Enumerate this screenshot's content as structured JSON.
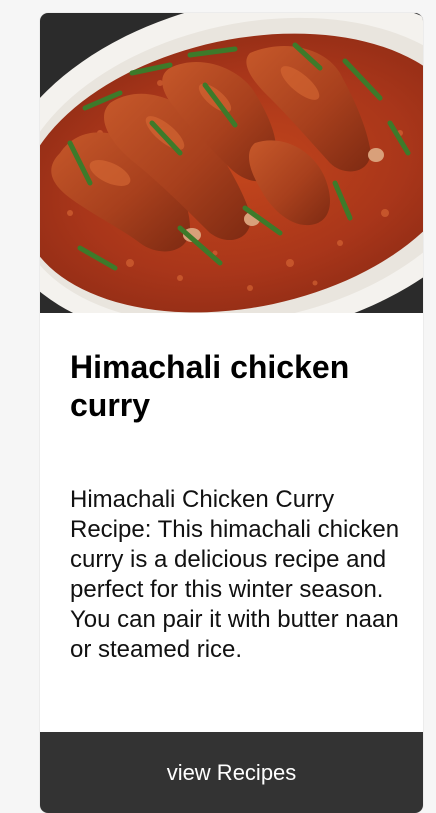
{
  "card": {
    "image": {
      "subject": "chicken curry with drumsticks in red gravy on a white oval platter"
    },
    "title": "Himachali chicken curry",
    "description": "Himachali Chicken Curry Recipe: This himachali chicken curry is a delicious recipe and perfect for this winter season. You can pair it with butter naan or steamed rice.",
    "button_label": "view Recipes"
  },
  "colors": {
    "page_background": "#f6f6f6",
    "card_background": "#ffffff",
    "button_background": "#333333",
    "button_text": "#ffffff",
    "curry_sauce": "#b8421a",
    "platter": "#f4f2ee"
  }
}
